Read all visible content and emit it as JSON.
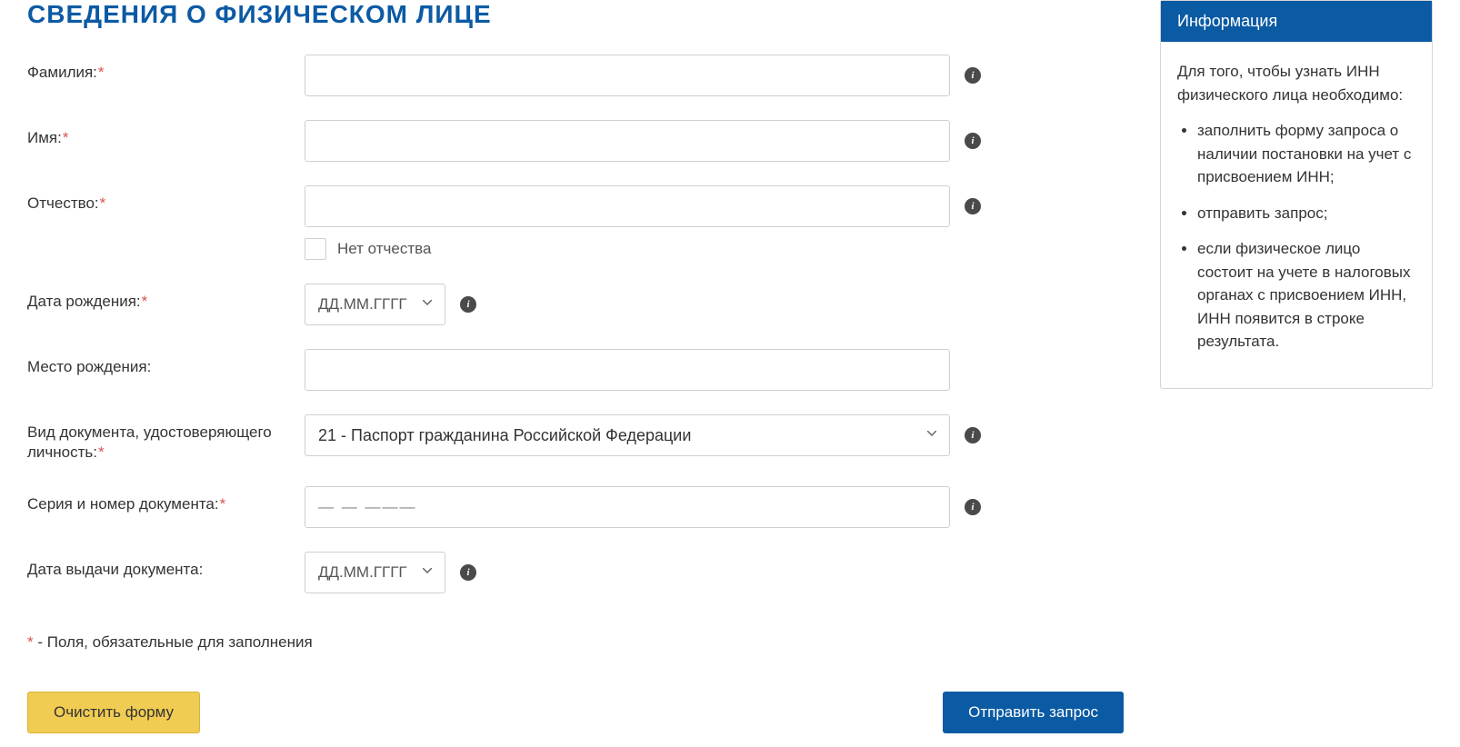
{
  "title": "СВЕДЕНИЯ О ФИЗИЧЕСКОМ ЛИЦЕ",
  "labels": {
    "surname": "Фамилия:",
    "name": "Имя:",
    "patronymic": "Отчество:",
    "no_patronymic": "Нет отчества",
    "birthdate": "Дата рождения:",
    "birthplace": "Место рождения:",
    "doc_type": "Вид документа, удостоверяющего личность:",
    "doc_series": "Серия и номер документа:",
    "doc_issue_date": "Дата выдачи документа:"
  },
  "placeholders": {
    "date": "ДД.ММ.ГГГГ",
    "doc_mask": "— —  ———"
  },
  "doc_type_selected": "21 - Паспорт гражданина Российской Федерации",
  "footnote_star": "*",
  "footnote_text": " - Поля, обязательные для заполнения",
  "buttons": {
    "clear": "Очистить форму",
    "submit": "Отправить запрос"
  },
  "sidebar": {
    "title": "Информация",
    "intro": "Для того, чтобы узнать ИНН физического лица необходимо:",
    "items": [
      "заполнить форму запроса о наличии постановки на учет с присвоением ИНН;",
      "отправить запрос;",
      "если физическое лицо состоит на учете в налоговых органах с присвоением ИНН, ИНН появится в строке результата."
    ]
  }
}
